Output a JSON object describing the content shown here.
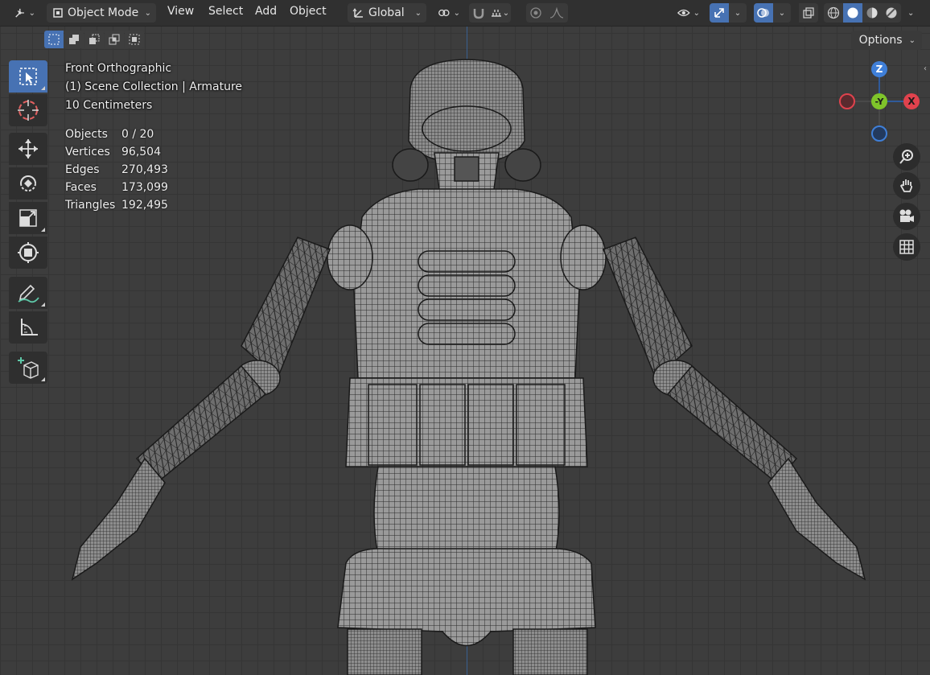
{
  "header": {
    "editor_type_icon": "axis-editor-icon",
    "mode": {
      "icon": "object-mode-icon",
      "label": "Object Mode"
    },
    "menus": [
      "View",
      "Select",
      "Add",
      "Object"
    ],
    "transform_orientation": {
      "icon": "orientation-icon",
      "label": "Global"
    },
    "pivot_icon": "link-pivot-icon",
    "snap_icon": "magnet-icon",
    "snap_target_icon": "snap-increment-icon",
    "proportional_edit_icon": "proportional-edit-icon",
    "falloff_icon": "falloff-curve-icon",
    "visibility_icon": "eye-visibility-icon",
    "gizmo_icon": "gizmo-arrows-icon",
    "overlays_icon": "overlays-icon",
    "xray_icon": "xray-icon",
    "shading_modes": [
      "wireframe",
      "solid",
      "material-preview",
      "rendered"
    ],
    "active_shading": "solid"
  },
  "select_modes": [
    "set",
    "extend",
    "subtract",
    "invert",
    "intersect"
  ],
  "options": {
    "label": "Options"
  },
  "toolbar": [
    "select-box",
    "cursor",
    "move",
    "rotate",
    "scale",
    "transform",
    "annotate",
    "measure",
    "add-cube"
  ],
  "overlay": {
    "view_name": "Front Orthographic",
    "collection": "(1) Scene Collection | Armature",
    "grid_scale": "10 Centimeters",
    "stats": [
      {
        "label": "Objects",
        "value": "0 / 20"
      },
      {
        "label": "Vertices",
        "value": "96,504"
      },
      {
        "label": "Edges",
        "value": "270,493"
      },
      {
        "label": "Faces",
        "value": "173,099"
      },
      {
        "label": "Triangles",
        "value": "192,495"
      }
    ]
  },
  "gizmo": {
    "z": "Z",
    "y": "-Y",
    "x": "X"
  },
  "nav_buttons": [
    "zoom",
    "pan",
    "camera",
    "ortho-grid"
  ],
  "colors": {
    "accent": "#4772b3",
    "axis_x": "#e0424d",
    "axis_y": "#7fc42a",
    "axis_z": "#3f7fd8"
  }
}
